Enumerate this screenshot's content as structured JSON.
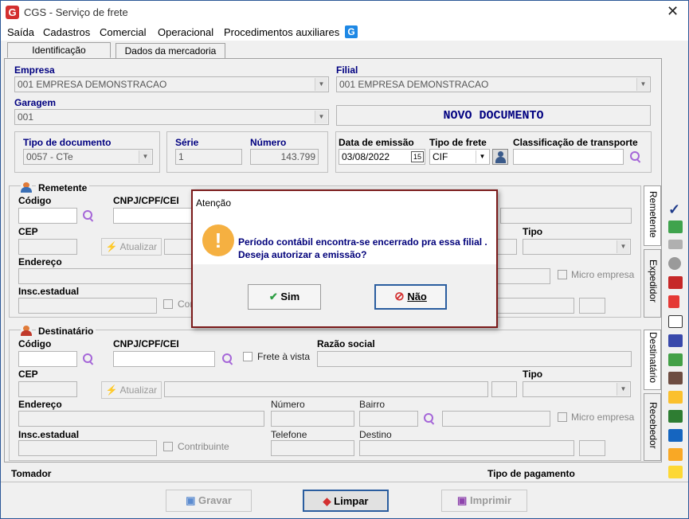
{
  "window": {
    "title": "CGS - Serviço de frete",
    "close": "✕"
  },
  "menu": [
    "Saída",
    "Cadastros",
    "Comercial",
    "Operacional",
    "Procedimentos auxiliares"
  ],
  "tabs": [
    "Identificação",
    "Dados da mercadoria"
  ],
  "ident": {
    "empresa_label": "Empresa",
    "empresa_value": "001 EMPRESA DEMONSTRACAO",
    "filial_label": "Filial",
    "filial_value": "001 EMPRESA DEMONSTRACAO",
    "garagem_label": "Garagem",
    "garagem_value": "001",
    "novo_documento": "NOVO DOCUMENTO",
    "tipo_doc_label": "Tipo de documento",
    "tipo_doc_value": "0057 - CTe",
    "serie_label": "Série",
    "serie_value": "1",
    "numero_label": "Número",
    "numero_value": "143.799",
    "data_emissao_label": "Data de emissão",
    "data_emissao_value": "03/08/2022",
    "cal_day": "15",
    "tipo_frete_label": "Tipo de frete",
    "tipo_frete_value": "CIF",
    "classif_label": "Classificação de transporte"
  },
  "remetente": {
    "title": "Remetente",
    "codigo": "Código",
    "cnpj": "CNPJ/CPF/CEI",
    "cep": "CEP",
    "atualizar": "Atualizar",
    "tipo": "Tipo",
    "endereco": "Endereço",
    "micro": "Micro empresa",
    "insc": "Insc.estadual",
    "contribuinte": "Con"
  },
  "destinatario": {
    "title": "Destinatário",
    "codigo": "Código",
    "cnpj": "CNPJ/CPF/CEI",
    "frete_vista": "Frete à vista",
    "razao": "Razão social",
    "cep": "CEP",
    "atualizar": "Atualizar",
    "tipo": "Tipo",
    "endereco": "Endereço",
    "numero": "Número",
    "bairro": "Bairro",
    "micro": "Micro empresa",
    "insc": "Insc.estadual",
    "contribuinte": "Contribuinte",
    "telefone": "Telefone",
    "destino": "Destino"
  },
  "side_tabs": [
    "Remetente",
    "Expedidor",
    "Destinatário",
    "Recebedor"
  ],
  "footer": {
    "tomador": "Tomador",
    "tipo_pagamento": "Tipo de pagamento"
  },
  "buttons": {
    "gravar": "Gravar",
    "limpar": "Limpar",
    "imprimir": "Imprimir"
  },
  "dialog": {
    "title": "Atenção",
    "line1": "Período contábil encontra-se encerrado pra essa filial .",
    "line2": "Deseja autorizar a emissão?",
    "sim": "Sim",
    "nao": "Não"
  },
  "colors": {
    "label_blue": "#000080",
    "dialog_border": "#7a1a1a",
    "warn": "#f5b041",
    "accent": "#a566d8"
  }
}
